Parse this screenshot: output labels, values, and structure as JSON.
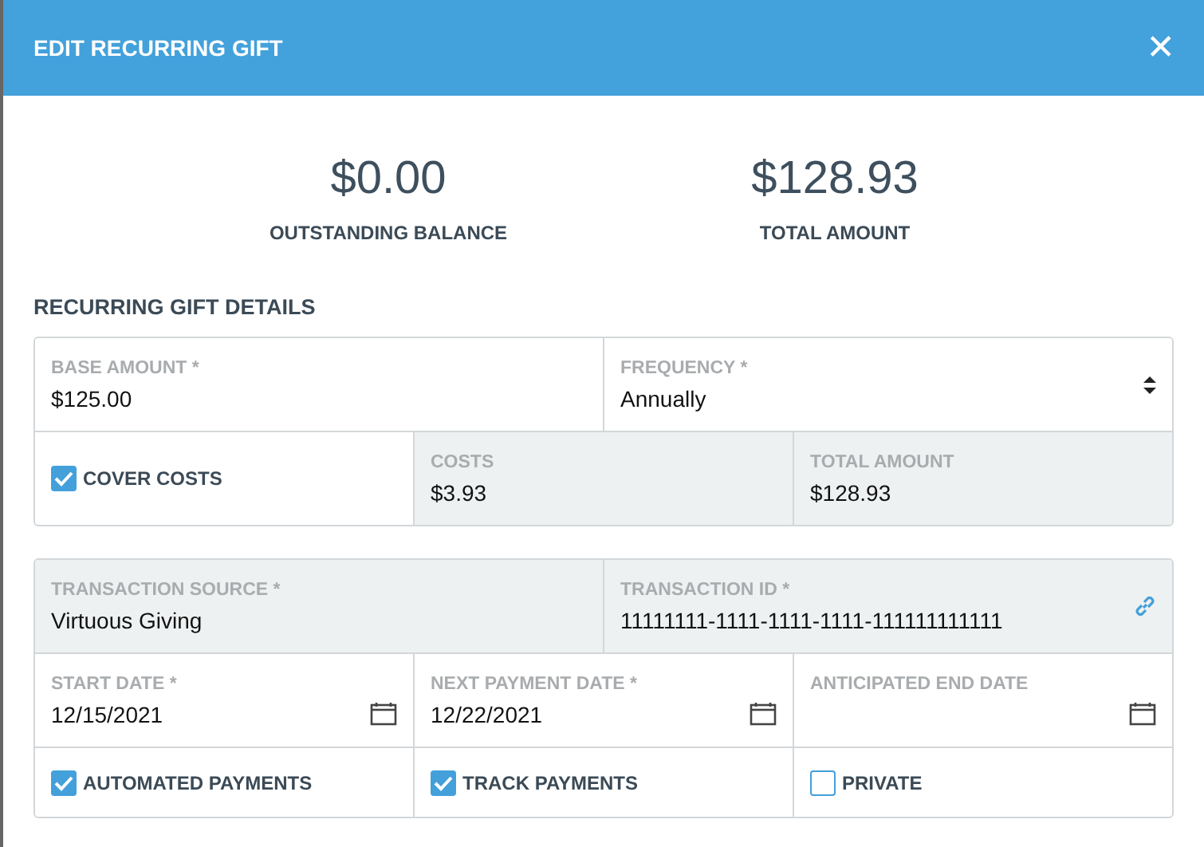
{
  "dialog": {
    "title": "EDIT RECURRING GIFT",
    "close": "✕"
  },
  "summary": [
    {
      "value": "$0.00",
      "label": "OUTSTANDING BALANCE"
    },
    {
      "value": "$128.93",
      "label": "TOTAL AMOUNT"
    }
  ],
  "section_title": "RECURRING GIFT DETAILS",
  "groups": [
    {
      "rows": [
        {
          "fields": [
            {
              "kind": "text",
              "label": "BASE AMOUNT  *",
              "value": "$125.00",
              "readonly": false
            },
            {
              "kind": "select",
              "label": "FREQUENCY *",
              "value": "Annually",
              "readonly": false
            }
          ]
        },
        {
          "fields": [
            {
              "kind": "checkbox",
              "label": "COVER COSTS",
              "checked": true
            },
            {
              "kind": "text",
              "label": "COSTS",
              "value": "$3.93",
              "readonly": true
            },
            {
              "kind": "text",
              "label": "TOTAL AMOUNT",
              "value": "$128.93",
              "readonly": true
            }
          ]
        }
      ]
    },
    {
      "rows": [
        {
          "fields": [
            {
              "kind": "text",
              "label": "TRANSACTION SOURCE *",
              "value": "Virtuous Giving",
              "readonly": true
            },
            {
              "kind": "link",
              "label": "TRANSACTION ID *",
              "value": "11111111-1111-1111-1111-111111111111",
              "readonly": true
            }
          ]
        },
        {
          "fields": [
            {
              "kind": "date",
              "label": "START DATE *",
              "value": "12/15/2021",
              "readonly": false
            },
            {
              "kind": "date",
              "label": "NEXT PAYMENT DATE *",
              "value": "12/22/2021",
              "readonly": false
            },
            {
              "kind": "date",
              "label": "ANTICIPATED END DATE",
              "readonly": false
            }
          ]
        },
        {
          "fields": [
            {
              "kind": "checkbox",
              "label": "AUTOMATED PAYMENTS",
              "checked": true
            },
            {
              "kind": "checkbox",
              "label": "TRACK PAYMENTS",
              "checked": true
            },
            {
              "kind": "checkbox",
              "label": "PRIVATE",
              "checked": false
            }
          ]
        }
      ]
    }
  ]
}
